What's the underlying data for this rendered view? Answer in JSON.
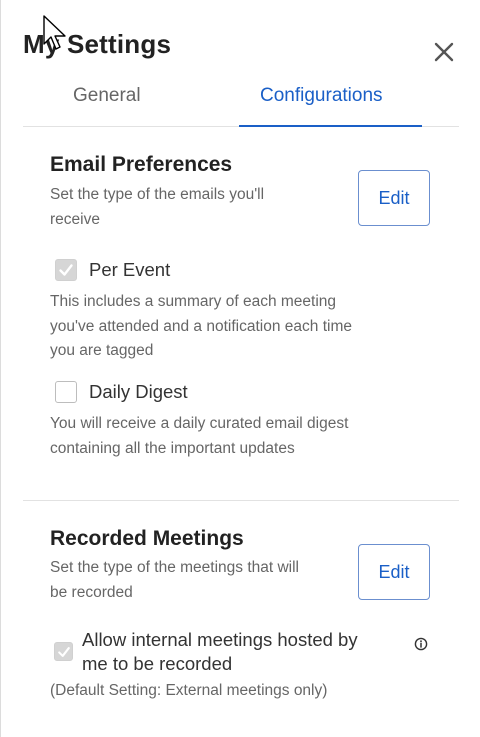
{
  "header": {
    "title": "My Settings"
  },
  "tabs": [
    {
      "label": "General",
      "active": false
    },
    {
      "label": "Configurations",
      "active": true
    }
  ],
  "email_preferences": {
    "title": "Email Preferences",
    "description_line1": "Set the type of the emails you'll",
    "description_line2": "receive",
    "edit_label": "Edit",
    "options": [
      {
        "label": "Per Event",
        "checked": true,
        "description": [
          "This includes a summary of each meeting",
          "you've attended and a notification each time",
          "you are tagged"
        ]
      },
      {
        "label": "Daily Digest",
        "checked": false,
        "description": [
          "You will receive a daily curated email digest",
          "containing all the important updates"
        ]
      }
    ]
  },
  "recorded_meetings": {
    "title": "Recorded Meetings",
    "description_line1": "Set the type of the meetings that will",
    "description_line2": "be recorded",
    "edit_label": "Edit",
    "option": {
      "label_line1": "Allow internal meetings hosted by",
      "label_line2": "me to be recorded",
      "checked": true
    },
    "default_note": "(Default Setting: External meetings only)"
  },
  "colors": {
    "accent": "#1a5fc7",
    "text": "#222222",
    "muted": "#666666"
  },
  "icons": {
    "close": "close-icon",
    "info": "info-icon",
    "check": "check-icon",
    "cursor": "mouse-cursor-icon"
  }
}
